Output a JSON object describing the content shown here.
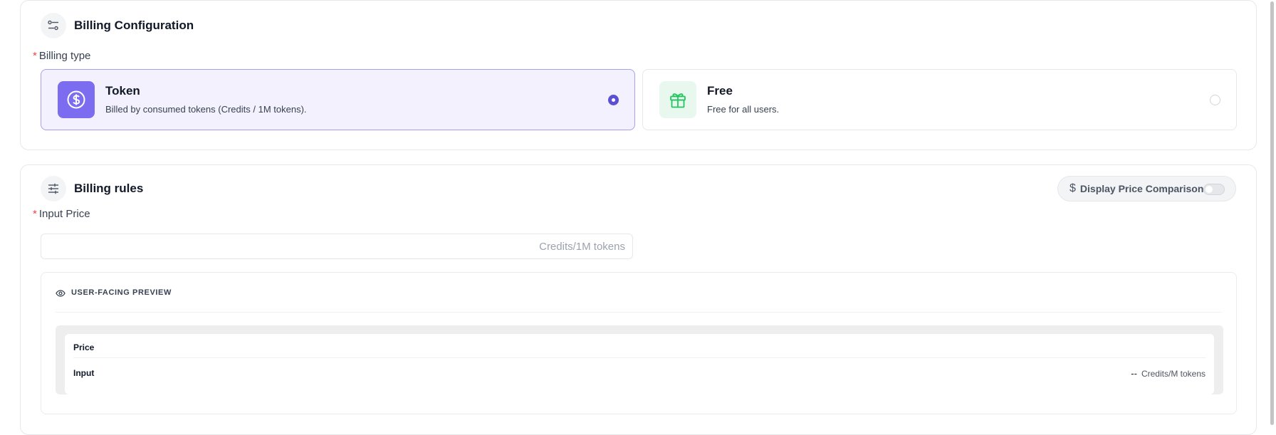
{
  "billing_config": {
    "title": "Billing Configuration",
    "billing_type_label": "Billing type",
    "required_mark": "*",
    "options": [
      {
        "title": "Token",
        "description": "Billed by consumed tokens (Credits / 1M tokens).",
        "icon": "dollar-circle-icon",
        "selected": true
      },
      {
        "title": "Free",
        "description": "Free for all users.",
        "icon": "gift-icon",
        "selected": false
      }
    ]
  },
  "billing_rules": {
    "title": "Billing rules",
    "compare_toggle": {
      "symbol": "$",
      "label": "Display Price Comparison",
      "enabled": false
    },
    "input_price": {
      "label": "Input Price",
      "required_mark": "*",
      "value": "",
      "placeholder": "Credits/1M tokens"
    },
    "preview": {
      "title": "USER-FACING PREVIEW",
      "price_header": "Price",
      "rows": [
        {
          "label": "Input",
          "value": "--",
          "unit": "Credits/M tokens"
        }
      ]
    }
  },
  "colors": {
    "accent": "#5b4fd6",
    "token_icon_bg": "#7c6cf0",
    "free_icon": "#22c55e",
    "required": "#ef4444"
  }
}
